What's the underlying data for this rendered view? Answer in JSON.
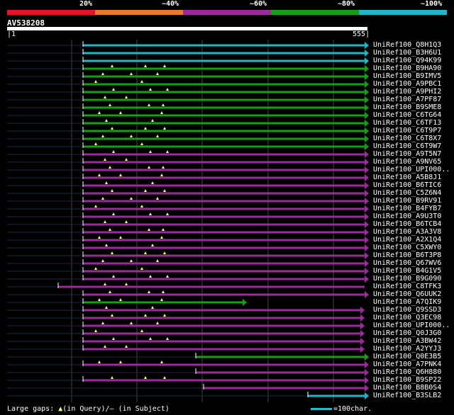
{
  "legend": {
    "labels": [
      "20%",
      "~40%",
      "~60%",
      "~80%",
      "~100%"
    ],
    "colors": [
      "#e8102a",
      "#e87a22",
      "#9c2a9c",
      "#14a014",
      "#1ab8c8"
    ]
  },
  "query": {
    "id": "AV538208",
    "start": "1",
    "end": "555"
  },
  "hits": [
    {
      "name": "UniRef100_Q8H1Q3",
      "color": "#1ab8c8"
    },
    {
      "name": "UniRef100_B3H6U1",
      "color": "#1ab8c8"
    },
    {
      "name": "UniRef100_Q94K99",
      "color": "#1ab8c8"
    },
    {
      "name": "UniRef100_B9HA90",
      "color": "#14a014"
    },
    {
      "name": "UniRef100_B9IMV5",
      "color": "#14a014"
    },
    {
      "name": "UniRef100_A9PBC1",
      "color": "#14a014"
    },
    {
      "name": "UniRef100_A9PHI2",
      "color": "#14a014"
    },
    {
      "name": "UniRef100_A7PF87",
      "color": "#14a014"
    },
    {
      "name": "UniRef100_B9SME8",
      "color": "#14a014"
    },
    {
      "name": "UniRef100_C6TG64",
      "color": "#14a014"
    },
    {
      "name": "UniRef100_C6TF13",
      "color": "#14a014"
    },
    {
      "name": "UniRef100_C6T9P7",
      "color": "#14a014"
    },
    {
      "name": "UniRef100_C6T8X7",
      "color": "#14a014"
    },
    {
      "name": "UniRef100_C6T9W7",
      "color": "#14a014"
    },
    {
      "name": "UniRef100_A9T5N7",
      "color": "#9c2a9c"
    },
    {
      "name": "UniRef100_A9NV65",
      "color": "#9c2a9c"
    },
    {
      "name": "UniRef100_UPI000..",
      "color": "#9c2a9c"
    },
    {
      "name": "UniRef100_A5B8J1",
      "color": "#9c2a9c"
    },
    {
      "name": "UniRef100_B6TIC6",
      "color": "#9c2a9c"
    },
    {
      "name": "UniRef100_C5Z6N4",
      "color": "#9c2a9c"
    },
    {
      "name": "UniRef100_B9RV91",
      "color": "#9c2a9c"
    },
    {
      "name": "UniRef100_B4FYB7",
      "color": "#9c2a9c"
    },
    {
      "name": "UniRef100_A9U3T0",
      "color": "#9c2a9c"
    },
    {
      "name": "UniRef100_B6TCB4",
      "color": "#9c2a9c"
    },
    {
      "name": "UniRef100_A3A3V8",
      "color": "#9c2a9c"
    },
    {
      "name": "UniRef100_A2X1Q4",
      "color": "#9c2a9c"
    },
    {
      "name": "UniRef100_C5XWY0",
      "color": "#9c2a9c"
    },
    {
      "name": "UniRef100_B6T3P8",
      "color": "#9c2a9c"
    },
    {
      "name": "UniRef100_Q67WV6",
      "color": "#9c2a9c"
    },
    {
      "name": "UniRef100_B4G1V5",
      "color": "#9c2a9c"
    },
    {
      "name": "UniRef100_B9G090",
      "color": "#9c2a9c"
    },
    {
      "name": "UniRef100_C8TFK3",
      "color": "#9c2a9c"
    },
    {
      "name": "UniRef100_Q6UUK2",
      "color": "#9c2a9c"
    },
    {
      "name": "UniRef100_A7QIK9",
      "color": "#14a014"
    },
    {
      "name": "UniRef100_Q9SSD3",
      "color": "#9c2a9c"
    },
    {
      "name": "UniRef100_Q3EC98",
      "color": "#9c2a9c"
    },
    {
      "name": "UniRef100_UPI000..",
      "color": "#9c2a9c"
    },
    {
      "name": "UniRef100_Q0J3G0",
      "color": "#9c2a9c"
    },
    {
      "name": "UniRef100_A3BW42",
      "color": "#9c2a9c"
    },
    {
      "name": "UniRef100_A2YYJ3",
      "color": "#9c2a9c"
    },
    {
      "name": "UniRef100_Q0E3B5",
      "color": "#14a014"
    },
    {
      "name": "UniRef100_A7PNK4",
      "color": "#9c2a9c"
    },
    {
      "name": "UniRef100_Q6H880",
      "color": "#9c2a9c"
    },
    {
      "name": "UniRef100_B9SP22",
      "color": "#9c2a9c"
    },
    {
      "name": "UniRef100_B8B0S4",
      "color": "#9c2a9c"
    },
    {
      "name": "UniRef100_B3SLB2",
      "color": "#1ab8c8"
    }
  ],
  "footer": {
    "prefix": "Large gaps: ",
    "triangle": "▲",
    "query_text": "(in Query)/",
    "dash": "–",
    "subject_text": " (in Subject)"
  },
  "scale": {
    "label": "=100char."
  }
}
